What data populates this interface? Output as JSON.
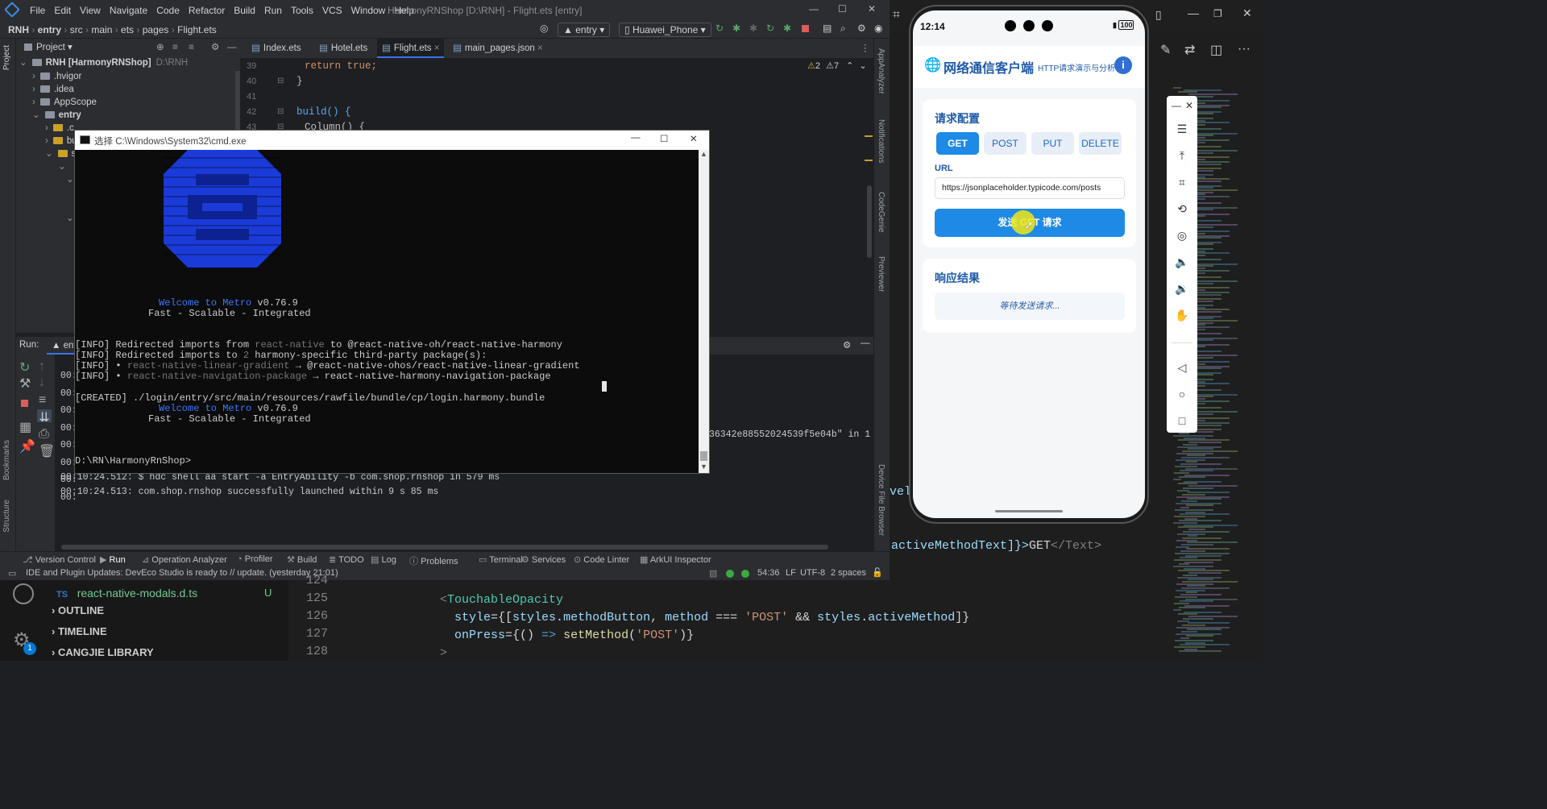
{
  "ide": {
    "menu": [
      "File",
      "Edit",
      "View",
      "Navigate",
      "Code",
      "Refactor",
      "Build",
      "Run",
      "Tools",
      "VCS",
      "Window",
      "Help"
    ],
    "window_title": "HarmonyRNShop [D:\\RNH] - Flight.ets [entry]",
    "breadcrumb": [
      "RNH",
      "entry",
      "src",
      "main",
      "ets",
      "pages",
      "Flight.ets"
    ],
    "run_config": "entry",
    "device": "Huawei_Phone",
    "project_label": "Project",
    "tree": [
      {
        "label": "RNH [HarmonyRNShop]",
        "path": "D:\\RNH"
      },
      {
        "label": ".hvigor"
      },
      {
        "label": ".idea"
      },
      {
        "label": "AppScope"
      },
      {
        "label": "entry"
      },
      {
        "label": ".c"
      },
      {
        "label": "bu"
      },
      {
        "label": "sr"
      }
    ],
    "tabs": [
      "Index.ets",
      "Hotel.ets",
      "Flight.ets",
      "main_pages.json"
    ],
    "line_numbers": [
      "39",
      "40",
      "41",
      "42",
      "43"
    ],
    "code_lines": [
      "return true;",
      "}",
      "",
      "build() {",
      "Column() {"
    ],
    "inspections": {
      "warnings": "2",
      "weak": "7"
    },
    "run_label": "Run:",
    "run_tab": "entry",
    "run_times": [
      "00:",
      "00:",
      "00:",
      "00:",
      "00:",
      "00:",
      "00:",
      "00:"
    ],
    "run_log": [
      "00:10:24.512: $ hdc shell aa start -a EntryAbility -b com.shop.rnshop in 579 ms",
      "00:10:24.513: com.shop.rnshop successfully launched within 9 s 85 ms"
    ],
    "run_log_tail": "36342e88552024539f5e04b\" in 1 s",
    "bottom_tools": [
      "Version Control",
      "Run",
      "Operation Analyzer",
      "Profiler",
      "Build",
      "TODO",
      "Log",
      "Problems",
      "Terminal",
      "Services",
      "Code Linter",
      "ArkUI Inspector"
    ],
    "status_message": "IDE and Plugin Updates: DevEco Studio is ready to // update. (yesterday 21:01)",
    "status_right": {
      "position": "54:36",
      "line_sep": "LF",
      "encoding": "UTF-8",
      "indent": "2 spaces"
    },
    "left_strip": [
      "Project",
      "Bookmarks",
      "Structure"
    ],
    "right_strip": [
      "AppAnalyzer",
      "Notifications",
      "CodeGenie",
      "Previewer",
      "Device File Browser"
    ]
  },
  "cmd": {
    "title": "选择 C:\\Windows\\System32\\cmd.exe",
    "welcome_prefix": "Welcome to Metro",
    "version": "v0.76.9",
    "tagline": "Fast - Scalable - Integrated",
    "info_lines": [
      {
        "tag": "[INFO]",
        "text": " Redirected imports from ",
        "gray": "react-native",
        "rest": " to @react-native-oh/react-native-harmony"
      },
      {
        "tag": "[INFO]",
        "text": " Redirected imports to ",
        "gray": "2",
        "rest": " harmony-specific third-party package(s):"
      },
      {
        "tag": "[INFO]",
        "text": " • ",
        "gray": "react-native-linear-gradient",
        "rest": " → @react-native-ohos/react-native-linear-gradient"
      },
      {
        "tag": "[INFO]",
        "text": " • ",
        "gray": "react-native-navigation-package",
        "rest": " → react-native-harmony-navigation-package"
      }
    ],
    "created": "[CREATED] ./login/entry/src/main/resources/rawfile/bundle/cp/login.harmony.bundle",
    "prompt": "D:\\RN\\HarmonyRnShop>"
  },
  "phone": {
    "time": "12:14",
    "battery": "100",
    "app_title": "网络通信客户端",
    "app_subtitle": "HTTP请求演示与分析",
    "config_title": "请求配置",
    "methods": [
      "GET",
      "POST",
      "PUT",
      "DELETE"
    ],
    "active_method": "GET",
    "url_label": "URL",
    "url_value": "https://jsonplaceholder.typicode.com/posts",
    "send_button": "发送 GET 请求",
    "response_title": "响应结果",
    "response_placeholder": "等待发送请求..."
  },
  "vscode": {
    "file_icon": "TS",
    "file": "react-native-modals.d.ts",
    "file_status": "U",
    "sections": [
      "OUTLINE",
      "TIMELINE",
      "CANGJIE LIBRARY"
    ],
    "badge": "1",
    "line_numbers": [
      "124",
      "125",
      "126",
      "127",
      "128"
    ],
    "right_code_1": "activeMethodText]}>",
    "right_code_1b": "GET",
    "right_code_1c": "</Text>",
    "right_code_0": "vel"
  },
  "colors": {
    "accent": "#1e8ae6",
    "ide_bg": "#1e1f22",
    "panel": "#2b2d30",
    "metro_blue": "#3b78ff"
  }
}
